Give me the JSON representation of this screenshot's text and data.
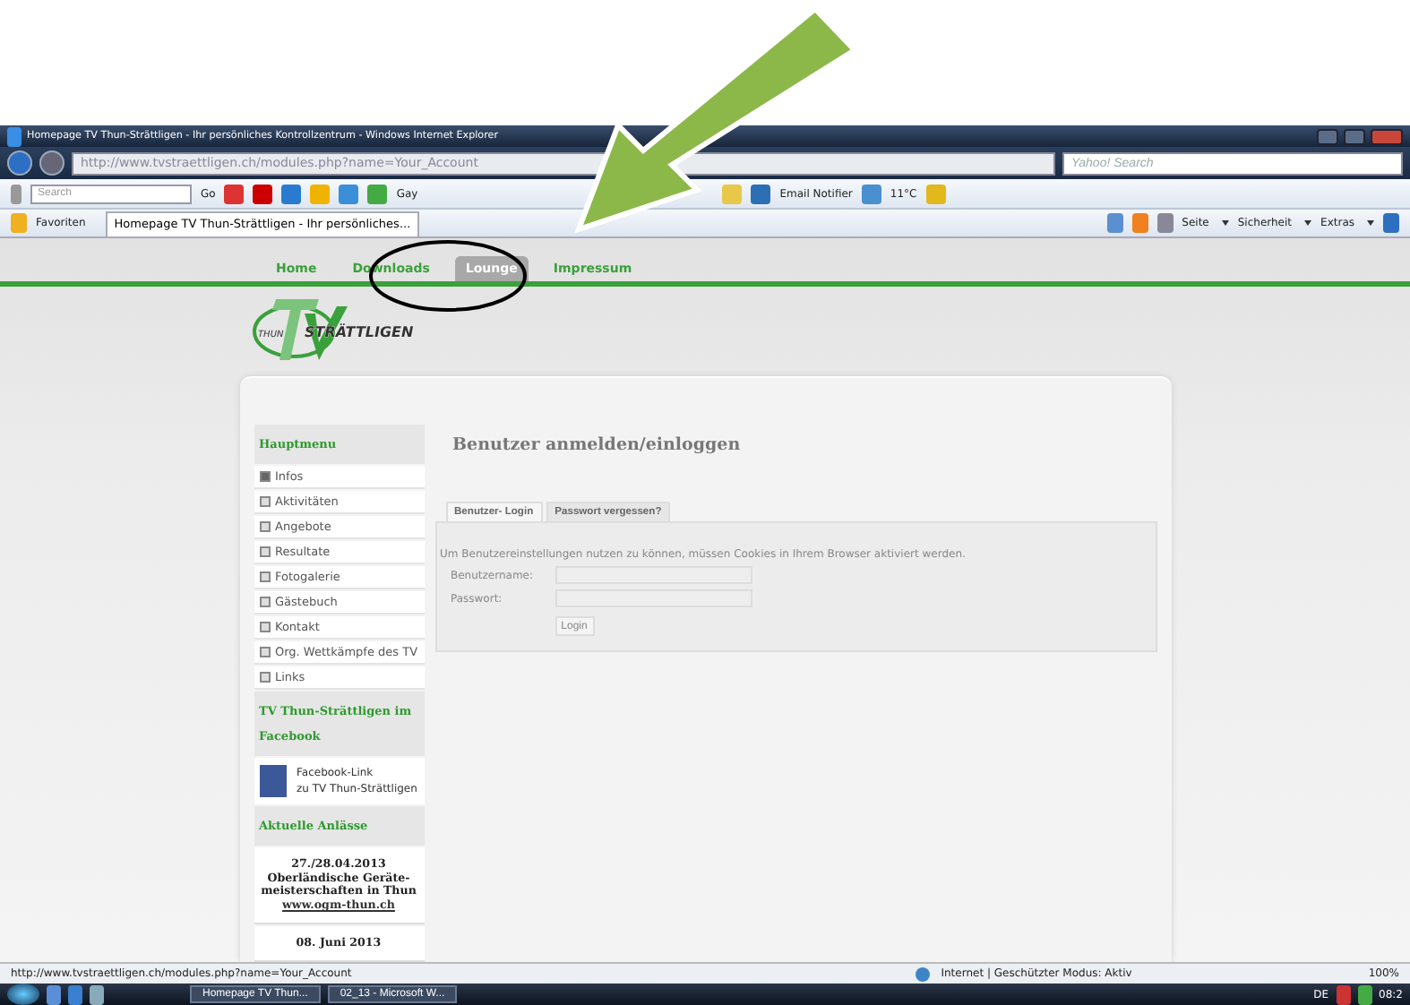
{
  "window": {
    "title": "Homepage TV Thun-Strättligen - Ihr persönliches Kontrollzentrum - Windows Internet Explorer"
  },
  "address_bar": {
    "url": "http://www.tvstraettligen.ch/modules.php?name=Your_Account"
  },
  "search_box": {
    "placeholder": "Yahoo! Search"
  },
  "toolbar": {
    "search_placeholder": "Search",
    "go_label": "Go",
    "partial_label": "Gay",
    "email_notifier": "Email Notifier",
    "weather": "11°C"
  },
  "favorites_bar": {
    "favorites": "Favoriten",
    "tab_title": "Homepage TV Thun-Strättligen - Ihr persönliches...",
    "commands": [
      "Seite",
      "Sicherheit",
      "Extras"
    ]
  },
  "page": {
    "nav": [
      {
        "label": "Home",
        "selected": false
      },
      {
        "label": "Downloads",
        "selected": false
      },
      {
        "label": "Lounge",
        "selected": true
      },
      {
        "label": "Impressum",
        "selected": false
      }
    ],
    "logo": {
      "small": "THUN",
      "big": "STRÄTTLIGEN"
    },
    "sidebar": {
      "main_menu_title": "Hauptmenu",
      "menu": [
        {
          "label": "Infos",
          "kind": "plus"
        },
        {
          "label": "Aktivitäten",
          "kind": "box"
        },
        {
          "label": "Angebote",
          "kind": "box"
        },
        {
          "label": "Resultate",
          "kind": "box"
        },
        {
          "label": "Fotogalerie",
          "kind": "box"
        },
        {
          "label": "Gästebuch",
          "kind": "box"
        },
        {
          "label": "Kontakt",
          "kind": "box"
        },
        {
          "label": "Org. Wettkämpfe des TV",
          "kind": "box"
        },
        {
          "label": "Links",
          "kind": "box"
        }
      ],
      "facebook_title": "TV Thun-Strättligen im Facebook",
      "facebook_link": [
        "Facebook-Link",
        "zu TV Thun-Strättligen"
      ],
      "events_title": "Aktuelle Anlässe",
      "events": [
        {
          "date": "27./28.04.2013",
          "text": "Oberländische Geräte-meisterschaften in Thun",
          "link": "www.ogm-thun.ch"
        },
        {
          "date": "08. Juni 2013"
        }
      ]
    },
    "main": {
      "heading": "Benutzer anmelden/einloggen",
      "tabs": [
        {
          "label": "Benutzer- Login",
          "selected": true
        },
        {
          "label": "Passwort vergessen?",
          "selected": false
        }
      ],
      "notice": "Um Benutzereinstellungen nutzen zu können, müssen Cookies in Ihrem Browser aktiviert werden.",
      "fields": [
        {
          "label": "Benutzername:"
        },
        {
          "label": "Passwort:"
        }
      ],
      "login_button": "Login"
    }
  },
  "status_bar": {
    "url": "http://www.tvstraettligen.ch/modules.php?name=Your_Account",
    "zone": "Internet | Geschützter Modus: Aktiv",
    "zoom": "100%"
  },
  "taskbar": {
    "tasks": [
      "Homepage TV Thun...",
      "02_13 - Microsoft W..."
    ],
    "language": "DE",
    "clock": "08:2"
  }
}
